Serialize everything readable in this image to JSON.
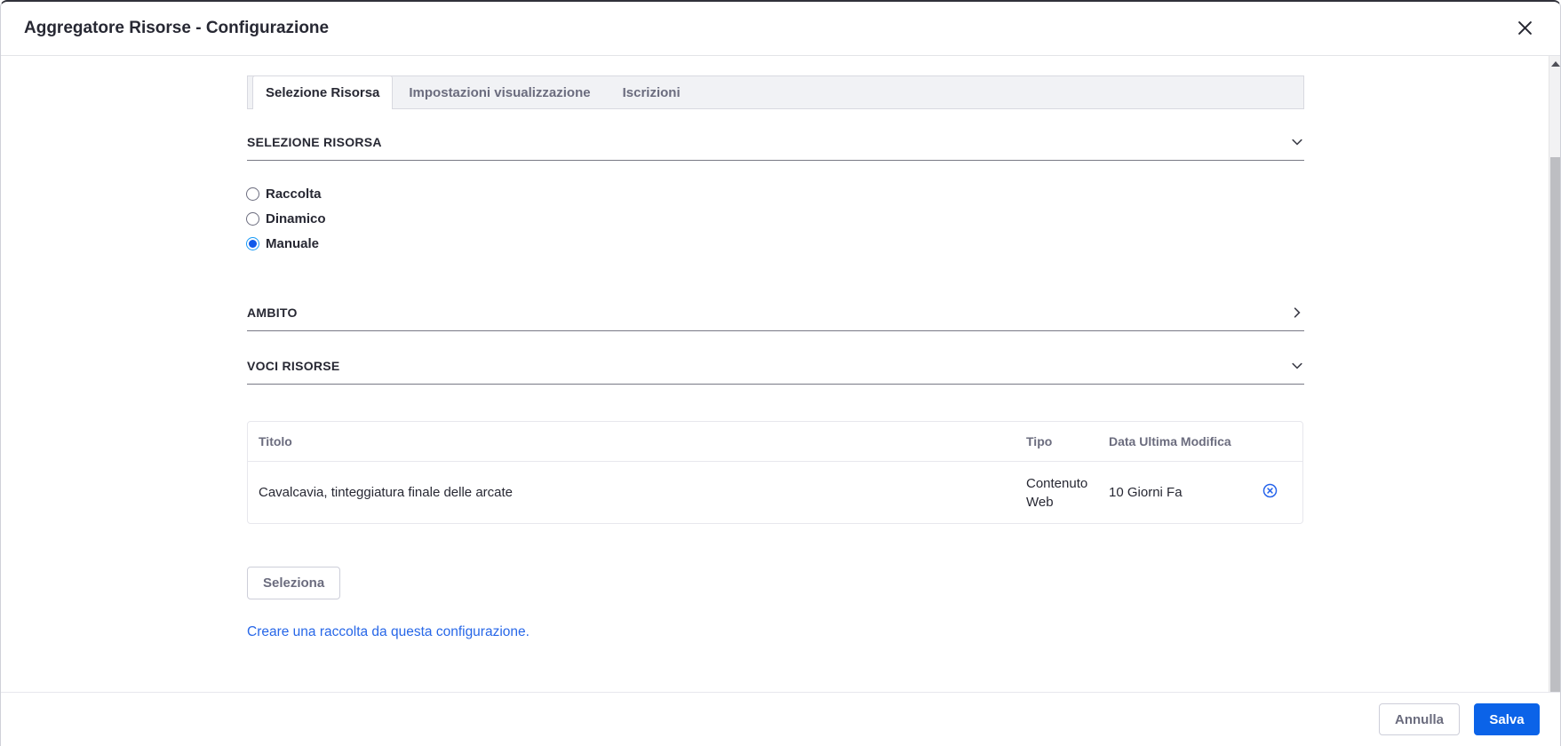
{
  "modal": {
    "title": "Aggregatore Risorse - Configurazione"
  },
  "tabs": [
    {
      "label": "Selezione Risorsa",
      "active": true
    },
    {
      "label": "Impostazioni visualizzazione",
      "active": false
    },
    {
      "label": "Iscrizioni",
      "active": false
    }
  ],
  "sections": {
    "selezione": {
      "title": "SELEZIONE RISORSA",
      "expanded": true
    },
    "ambito": {
      "title": "AMBITO",
      "expanded": false
    },
    "voci": {
      "title": "VOCI RISORSE",
      "expanded": true
    }
  },
  "radio_options": [
    {
      "label": "Raccolta",
      "selected": false
    },
    {
      "label": "Dinamico",
      "selected": false
    },
    {
      "label": "Manuale",
      "selected": true
    }
  ],
  "table": {
    "columns": [
      "Titolo",
      "Tipo",
      "Data Ultima Modifica"
    ],
    "rows": [
      {
        "titolo": "Cavalcavia, tinteggiatura finale delle arcate",
        "tipo": "Contenuto Web",
        "data_ultima_modifica": "10 Giorni Fa"
      }
    ]
  },
  "actions": {
    "seleziona_label": "Seleziona",
    "create_collection_link": "Creare una raccolta da questa configurazione."
  },
  "footer": {
    "annulla_label": "Annulla",
    "salva_label": "Salva"
  },
  "icons": {
    "close": "close-icon",
    "chevron_down": "chevron-down-icon",
    "chevron_right": "chevron-right-icon",
    "delete_row": "times-circle-icon",
    "scroll_up": "scroll-up-arrow-icon"
  },
  "colors": {
    "primary_button": "#0b63e8",
    "link_blue": "#2767e8",
    "radio_ring_blue": "#189af6",
    "radio_dot_blue": "#1059ea",
    "delete_icon_blue": "#2563eb",
    "text_dark": "#272833",
    "text_muted": "#6b6c7e"
  }
}
